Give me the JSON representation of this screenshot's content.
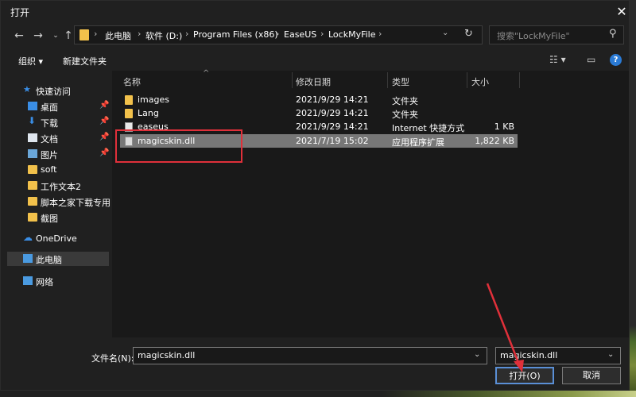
{
  "window": {
    "title": "打开"
  },
  "address": {
    "crumbs": [
      "此电脑",
      "软件 (D:)",
      "Program Files (x86)",
      "EaseUS",
      "LockMyFile"
    ]
  },
  "search": {
    "placeholder": "搜索\"LockMyFile\""
  },
  "toolbar": {
    "organize": "组织 ▾",
    "new_folder": "新建文件夹"
  },
  "sidebar": {
    "items": [
      {
        "label": "快速访问",
        "icon": "star-icon"
      },
      {
        "label": "桌面",
        "icon": "desktop-icon"
      },
      {
        "label": "下载",
        "icon": "download-icon"
      },
      {
        "label": "文档",
        "icon": "document-icon"
      },
      {
        "label": "图片",
        "icon": "picture-icon"
      },
      {
        "label": "soft",
        "icon": "folder-icon"
      },
      {
        "label": "工作文本2",
        "icon": "folder-icon"
      },
      {
        "label": "脚本之家下载专用",
        "icon": "folder-icon"
      },
      {
        "label": "截图",
        "icon": "folder-icon"
      },
      {
        "label": "OneDrive",
        "icon": "cloud-icon"
      },
      {
        "label": "此电脑",
        "icon": "computer-icon"
      },
      {
        "label": "网络",
        "icon": "network-icon"
      }
    ]
  },
  "list": {
    "columns": {
      "name": "名称",
      "date": "修改日期",
      "type": "类型",
      "size": "大小"
    },
    "rows": [
      {
        "name": "images",
        "date": "2021/9/29 14:21",
        "type": "文件夹",
        "size": ""
      },
      {
        "name": "Lang",
        "date": "2021/9/29 14:21",
        "type": "文件夹",
        "size": ""
      },
      {
        "name": "easeus",
        "date": "2021/9/29 14:21",
        "type": "Internet 快捷方式",
        "size": "1 KB"
      },
      {
        "name": "magicskin.dll",
        "date": "2021/7/19 15:02",
        "type": "应用程序扩展",
        "size": "1,822 KB"
      }
    ]
  },
  "footer": {
    "filename_label": "文件名(N):",
    "filename_value": "magicskin.dll",
    "filetype_value": "magicskin.dll",
    "open_label": "打开(O)",
    "cancel_label": "取消"
  },
  "colors": {
    "accent": "#2a7ad5",
    "annotation": "#e0303a",
    "folder": "#f2c14b"
  }
}
